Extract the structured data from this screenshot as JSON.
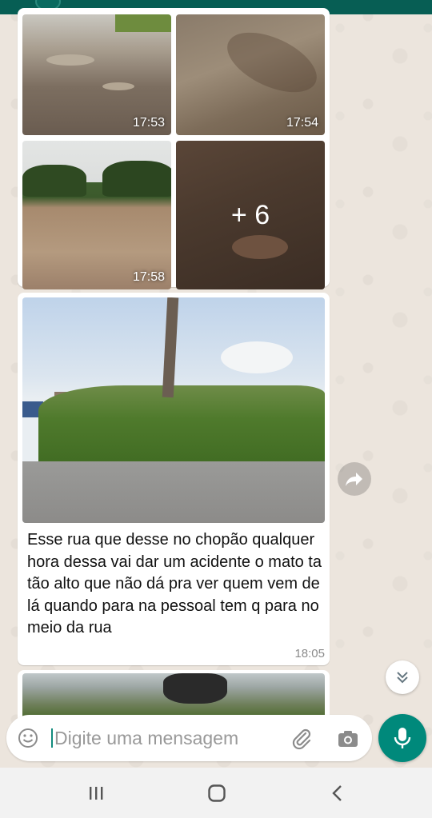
{
  "album": {
    "thumbs": [
      {
        "time": "17:53"
      },
      {
        "time": "17:54"
      },
      {
        "time": "17:58"
      },
      {
        "more_label": "+ 6"
      }
    ]
  },
  "message": {
    "caption": "Esse rua que desse no chopão qualquer hora dessa vai dar um acidente o mato ta tão alto que não dá pra ver quem vem de lá quando para na pessoal tem q para no meio da rua",
    "time": "18:05"
  },
  "composer": {
    "placeholder": "Digite uma mensagem"
  },
  "icons": {
    "emoji": "emoji-icon",
    "attach": "paperclip-icon",
    "camera": "camera-icon",
    "mic": "microphone-icon",
    "forward": "forward-icon",
    "scroll_down": "double-chevron-down-icon",
    "nav_recents": "recents-icon",
    "nav_home": "home-icon",
    "nav_back": "back-icon"
  },
  "colors": {
    "header": "#075e54",
    "accent": "#00897b",
    "wallpaper": "#ece5dd"
  }
}
